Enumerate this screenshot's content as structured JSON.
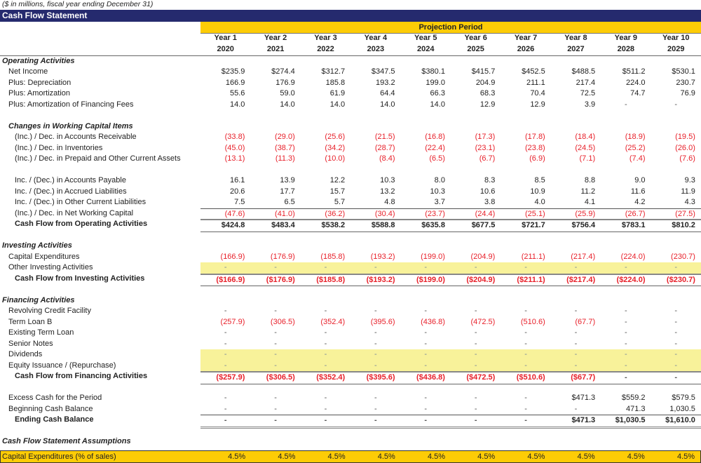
{
  "subtitle": "($ in millions, fiscal year ending December 31)",
  "title": "Cash Flow Statement",
  "projection_label": "Projection Period",
  "years": [
    {
      "label": "Year 1",
      "year": "2020"
    },
    {
      "label": "Year 2",
      "year": "2021"
    },
    {
      "label": "Year 3",
      "year": "2022"
    },
    {
      "label": "Year 4",
      "year": "2023"
    },
    {
      "label": "Year 5",
      "year": "2024"
    },
    {
      "label": "Year 6",
      "year": "2025"
    },
    {
      "label": "Year 7",
      "year": "2026"
    },
    {
      "label": "Year 8",
      "year": "2027"
    },
    {
      "label": "Year 9",
      "year": "2028"
    },
    {
      "label": "Year 10",
      "year": "2029"
    }
  ],
  "colors": {
    "header_bg": "#252a6e",
    "accent_yellow": "#fdcc06",
    "input_band": "#f8f29a",
    "negative": "#e8202a"
  },
  "rows": [
    {
      "type": "section",
      "label": "Operating Activities"
    },
    {
      "label": "Net Income",
      "indent": 1,
      "values": [
        "$235.9",
        "$274.4",
        "$312.7",
        "$347.5",
        "$380.1",
        "$415.7",
        "$452.5",
        "$488.5",
        "$511.2",
        "$530.1"
      ]
    },
    {
      "label": "Plus: Depreciation",
      "indent": 1,
      "values": [
        "166.9",
        "176.9",
        "185.8",
        "193.2",
        "199.0",
        "204.9",
        "211.1",
        "217.4",
        "224.0",
        "230.7"
      ]
    },
    {
      "label": "Plus: Amortization",
      "indent": 1,
      "values": [
        "55.6",
        "59.0",
        "61.9",
        "64.4",
        "66.3",
        "68.3",
        "70.4",
        "72.5",
        "74.7",
        "76.9"
      ]
    },
    {
      "label": "Plus: Amortization of Financing Fees",
      "indent": 1,
      "values": [
        "14.0",
        "14.0",
        "14.0",
        "14.0",
        "14.0",
        "12.9",
        "12.9",
        "3.9",
        "-",
        "-"
      ]
    },
    {
      "type": "gap"
    },
    {
      "type": "subsection",
      "label": "Changes in Working Capital Items"
    },
    {
      "label": "(Inc.) / Dec. in Accounts Receivable",
      "indent": 2,
      "neg": true,
      "values": [
        "(33.8)",
        "(29.0)",
        "(25.6)",
        "(21.5)",
        "(16.8)",
        "(17.3)",
        "(17.8)",
        "(18.4)",
        "(18.9)",
        "(19.5)"
      ]
    },
    {
      "label": "(Inc.) / Dec. in Inventories",
      "indent": 2,
      "neg": true,
      "values": [
        "(45.0)",
        "(38.7)",
        "(34.2)",
        "(28.7)",
        "(22.4)",
        "(23.1)",
        "(23.8)",
        "(24.5)",
        "(25.2)",
        "(26.0)"
      ]
    },
    {
      "label": "(Inc.) / Dec. in Prepaid and Other Current Assets",
      "indent": 2,
      "neg": true,
      "values": [
        "(13.1)",
        "(11.3)",
        "(10.0)",
        "(8.4)",
        "(6.5)",
        "(6.7)",
        "(6.9)",
        "(7.1)",
        "(7.4)",
        "(7.6)"
      ]
    },
    {
      "type": "gap"
    },
    {
      "label": "Inc. / (Dec.) in Accounts Payable",
      "indent": 2,
      "values": [
        "16.1",
        "13.9",
        "12.2",
        "10.3",
        "8.0",
        "8.3",
        "8.5",
        "8.8",
        "9.0",
        "9.3"
      ]
    },
    {
      "label": "Inc. / (Dec.) in Accrued Liabilities",
      "indent": 2,
      "values": [
        "20.6",
        "17.7",
        "15.7",
        "13.2",
        "10.3",
        "10.6",
        "10.9",
        "11.2",
        "11.6",
        "11.9"
      ]
    },
    {
      "label": "Inc. / (Dec.) in Other Current Liabilities",
      "indent": 2,
      "values": [
        "7.5",
        "6.5",
        "5.7",
        "4.8",
        "3.7",
        "3.8",
        "4.0",
        "4.1",
        "4.2",
        "4.3"
      ]
    },
    {
      "label": "(Inc.) / Dec. in Net Working Capital",
      "indent": 2,
      "neg": true,
      "border": "top",
      "values": [
        "(47.6)",
        "(41.0)",
        "(36.2)",
        "(30.4)",
        "(23.7)",
        "(24.4)",
        "(25.1)",
        "(25.9)",
        "(26.7)",
        "(27.5)"
      ]
    },
    {
      "label": "Cash Flow from Operating Activities",
      "indent": 2,
      "bold": true,
      "border": "topbottom",
      "values": [
        "$424.8",
        "$483.4",
        "$538.2",
        "$588.8",
        "$635.8",
        "$677.5",
        "$721.7",
        "$756.4",
        "$783.1",
        "$810.2"
      ]
    },
    {
      "type": "gap"
    },
    {
      "type": "section",
      "label": "Investing Activities"
    },
    {
      "label": "Capital Expenditures",
      "indent": 1,
      "neg": true,
      "values": [
        "(166.9)",
        "(176.9)",
        "(185.8)",
        "(193.2)",
        "(199.0)",
        "(204.9)",
        "(211.1)",
        "(217.4)",
        "(224.0)",
        "(230.7)"
      ]
    },
    {
      "label": "Other Investing Activities",
      "indent": 1,
      "yellow": true,
      "values": [
        "-",
        "-",
        "-",
        "-",
        "-",
        "-",
        "-",
        "-",
        "-",
        "-"
      ]
    },
    {
      "label": "Cash Flow from Investing Activities",
      "indent": 2,
      "bold": true,
      "neg": true,
      "border": "topbottom",
      "values": [
        "($166.9)",
        "($176.9)",
        "($185.8)",
        "($193.2)",
        "($199.0)",
        "($204.9)",
        "($211.1)",
        "($217.4)",
        "($224.0)",
        "($230.7)"
      ]
    },
    {
      "type": "gap"
    },
    {
      "type": "section",
      "label": "Financing Activities"
    },
    {
      "label": "Revolving Credit Facility",
      "indent": 1,
      "values": [
        "-",
        "-",
        "-",
        "-",
        "-",
        "-",
        "-",
        "-",
        "-",
        "-"
      ]
    },
    {
      "label": "Term Loan B",
      "indent": 1,
      "neg": true,
      "values": [
        "(257.9)",
        "(306.5)",
        "(352.4)",
        "(395.6)",
        "(436.8)",
        "(472.5)",
        "(510.6)",
        "(67.7)",
        "-",
        "-"
      ]
    },
    {
      "label": "Existing Term Loan",
      "indent": 1,
      "values": [
        "-",
        "-",
        "-",
        "-",
        "-",
        "-",
        "-",
        "-",
        "-",
        "-"
      ]
    },
    {
      "label": "Senior Notes",
      "indent": 1,
      "values": [
        "-",
        "-",
        "-",
        "-",
        "-",
        "-",
        "-",
        "-",
        "-",
        "-"
      ]
    },
    {
      "label": "Dividends",
      "indent": 1,
      "yellow": true,
      "values": [
        "-",
        "-",
        "-",
        "-",
        "-",
        "-",
        "-",
        "-",
        "-",
        "-"
      ]
    },
    {
      "label": "Equity Issuance / (Repurchase)",
      "indent": 1,
      "yellow": true,
      "values": [
        "-",
        "-",
        "-",
        "-",
        "-",
        "-",
        "-",
        "-",
        "-",
        "-"
      ]
    },
    {
      "label": "Cash Flow from Financing Activities",
      "indent": 2,
      "bold": true,
      "neg": true,
      "border": "topbottom",
      "values": [
        "($257.9)",
        "($306.5)",
        "($352.4)",
        "($395.6)",
        "($436.8)",
        "($472.5)",
        "($510.6)",
        "($67.7)",
        "-",
        "-"
      ]
    },
    {
      "type": "gap"
    },
    {
      "label": "Excess Cash for the Period",
      "indent": 1,
      "values": [
        "-",
        "-",
        "-",
        "-",
        "-",
        "-",
        "-",
        "$471.3",
        "$559.2",
        "$579.5"
      ]
    },
    {
      "label": "Beginning Cash Balance",
      "indent": 1,
      "values": [
        "-",
        "-",
        "-",
        "-",
        "-",
        "-",
        "-",
        "-",
        "471.3",
        "1,030.5"
      ]
    },
    {
      "label": "Ending Cash Balance",
      "indent": 2,
      "bold": true,
      "border": "topdouble",
      "values": [
        "-",
        "-",
        "-",
        "-",
        "-",
        "-",
        "-",
        "$471.3",
        "$1,030.5",
        "$1,610.0"
      ]
    },
    {
      "type": "gap"
    },
    {
      "type": "section",
      "label": "Cash Flow Statement Assumptions"
    }
  ],
  "assumption": {
    "label": "Capital Expenditures (% of sales)",
    "values": [
      "4.5%",
      "4.5%",
      "4.5%",
      "4.5%",
      "4.5%",
      "4.5%",
      "4.5%",
      "4.5%",
      "4.5%",
      "4.5%"
    ]
  }
}
